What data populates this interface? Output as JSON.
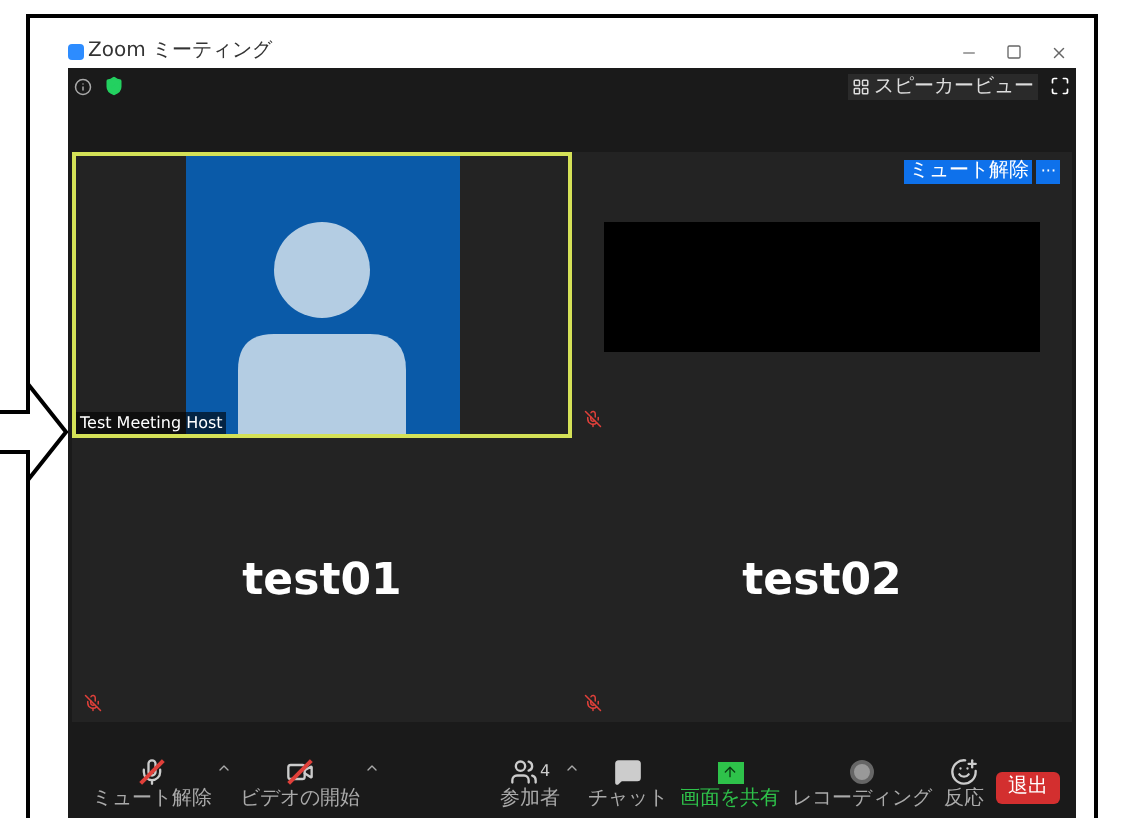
{
  "window": {
    "title": "Zoom ミーティング"
  },
  "top_bar": {
    "view_button": "スピーカービュー"
  },
  "tiles": [
    {
      "kind": "video",
      "name_label": "Test Meeting Host",
      "active_speaker": true,
      "muted": false
    },
    {
      "kind": "dark_video",
      "unmute_button": "ミュート解除",
      "more_button": "···",
      "active_speaker": false,
      "muted": true
    },
    {
      "kind": "name",
      "name": "test01",
      "active_speaker": false,
      "muted": true
    },
    {
      "kind": "name",
      "name": "test02",
      "active_speaker": false,
      "muted": true
    }
  ],
  "toolbar": [
    {
      "kind": "mic",
      "label": "ミュート解除",
      "crossed": true,
      "caret": true,
      "highlighted": false
    },
    {
      "kind": "video",
      "label": "ビデオの開始",
      "crossed": true,
      "caret": true,
      "highlighted": false
    },
    {
      "kind": "participants",
      "label": "参加者",
      "count": "4",
      "crossed": false,
      "caret": true,
      "highlighted": false
    },
    {
      "kind": "chat",
      "label": "チャット",
      "crossed": false,
      "caret": false,
      "highlighted": false
    },
    {
      "kind": "share",
      "label": "画面を共有",
      "crossed": false,
      "caret": false,
      "highlighted": true
    },
    {
      "kind": "record",
      "label": "レコーディング",
      "crossed": false,
      "caret": false,
      "highlighted": false
    },
    {
      "kind": "reactions",
      "label": "反応",
      "crossed": false,
      "caret": false,
      "highlighted": false
    }
  ],
  "leave_button": "退出"
}
